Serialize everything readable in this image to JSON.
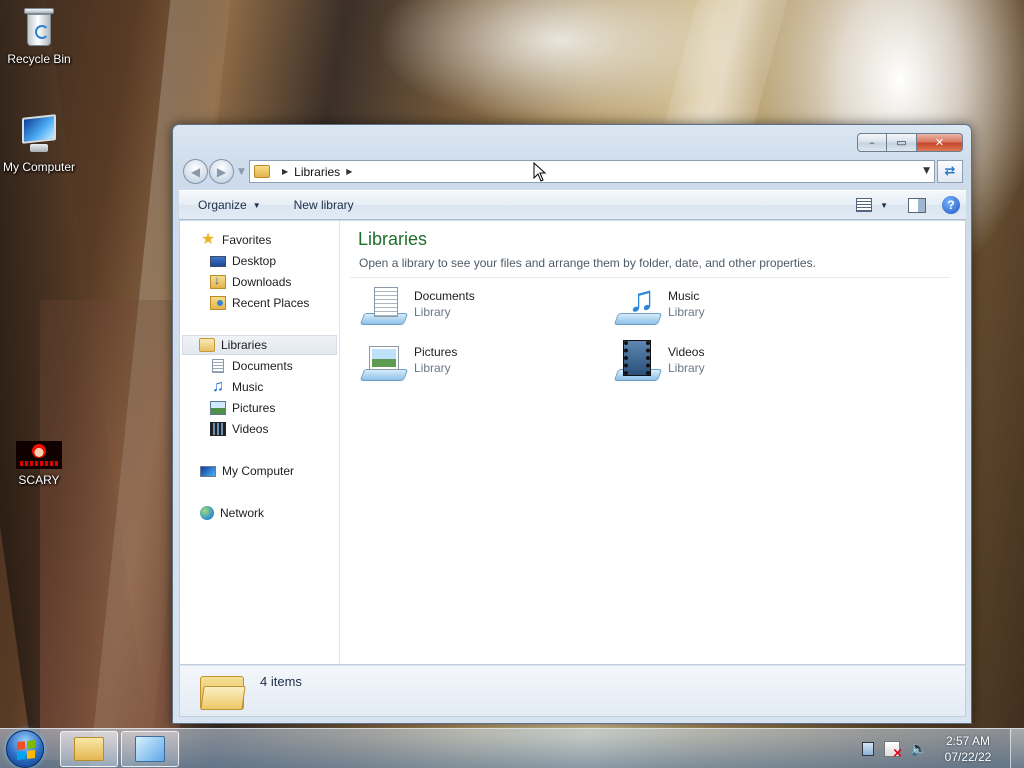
{
  "desktop": {
    "icons": [
      {
        "label": "Recycle Bin",
        "icon": "recycle-bin-icon"
      },
      {
        "label": "My Computer",
        "icon": "computer-icon"
      },
      {
        "label": "SCARY",
        "icon": "mario-icon"
      }
    ]
  },
  "window": {
    "controls": {
      "minimize": "–",
      "maximize": "▭",
      "close": "✕"
    },
    "address": {
      "crumbs": [
        "Libraries"
      ]
    },
    "toolbar": {
      "organize": "Organize",
      "new_library": "New library"
    },
    "nav_pane": {
      "favorites": {
        "label": "Favorites",
        "items": [
          "Desktop",
          "Downloads",
          "Recent Places"
        ]
      },
      "libraries": {
        "label": "Libraries",
        "items": [
          "Documents",
          "Music",
          "Pictures",
          "Videos"
        ]
      },
      "computer": "My Computer",
      "network": "Network"
    },
    "content": {
      "title": "Libraries",
      "description": "Open a library to see your files and arrange them by folder, date, and other properties.",
      "items": [
        {
          "name": "Documents",
          "kind": "Library",
          "icon": "documents-library-icon"
        },
        {
          "name": "Music",
          "kind": "Library",
          "icon": "music-library-icon"
        },
        {
          "name": "Pictures",
          "kind": "Library",
          "icon": "pictures-library-icon"
        },
        {
          "name": "Videos",
          "kind": "Library",
          "icon": "videos-library-icon"
        }
      ]
    },
    "details": {
      "count": "4 items"
    }
  },
  "taskbar": {
    "buttons": [
      "Windows Explorer",
      "Control Panel"
    ],
    "clock": {
      "time": "2:57 AM",
      "date": "07/22/22"
    }
  },
  "colors": {
    "heading": "#1e6e2b",
    "accent": "#2b77c6"
  }
}
